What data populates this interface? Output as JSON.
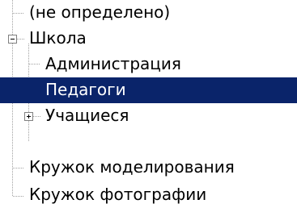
{
  "tree": {
    "nodes": [
      {
        "label": "(не определено)"
      },
      {
        "label": "Школа",
        "state": "expanded"
      },
      {
        "label": "Администрация"
      },
      {
        "label": "Педагоги",
        "selected": true
      },
      {
        "label": "Учащиеся",
        "state": "collapsed"
      },
      {
        "label": "Кружок моделирования"
      },
      {
        "label": "Кружок фотографии"
      }
    ]
  },
  "colors": {
    "selection_background": "#0a246a",
    "selection_text": "#ffffff",
    "tree_line": "#a0a0a0",
    "toggle_border": "#808080"
  }
}
